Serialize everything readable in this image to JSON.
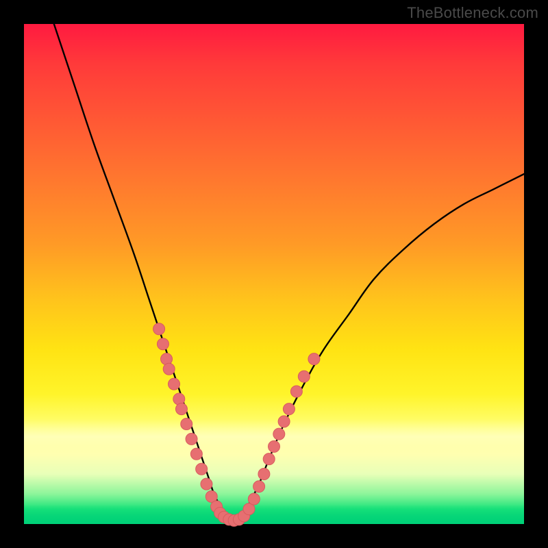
{
  "watermark": "TheBottleneck.com",
  "colors": {
    "frame": "#000000",
    "curve_stroke": "#000000",
    "marker_fill": "#e76f71",
    "marker_stroke": "#d85c5e",
    "gradient_top": "#ff1a40",
    "gradient_bottom": "#00d074"
  },
  "chart_data": {
    "type": "line",
    "title": "",
    "xlabel": "",
    "ylabel": "",
    "xlim": [
      0,
      100
    ],
    "ylim": [
      0,
      100
    ],
    "grid": false,
    "legend": false,
    "series": [
      {
        "name": "bottleneck-curve",
        "x": [
          6,
          10,
          14,
          18,
          22,
          25,
          27,
          29,
          31,
          33,
          35,
          36,
          37,
          38,
          39,
          40,
          41,
          42,
          43,
          44,
          45,
          47,
          49,
          52,
          56,
          60,
          65,
          70,
          76,
          82,
          88,
          94,
          100
        ],
        "y": [
          100,
          88,
          76,
          65,
          54,
          45,
          39,
          33,
          27,
          21,
          15,
          12,
          9,
          6,
          4,
          2,
          1,
          0,
          1,
          2,
          4,
          8,
          13,
          20,
          28,
          35,
          42,
          49,
          55,
          60,
          64,
          67,
          70
        ]
      }
    ],
    "markers": {
      "name": "highlighted-points",
      "points": [
        {
          "x": 27.0,
          "y": 39
        },
        {
          "x": 27.8,
          "y": 36
        },
        {
          "x": 28.5,
          "y": 33
        },
        {
          "x": 29.0,
          "y": 31
        },
        {
          "x": 30.0,
          "y": 28
        },
        {
          "x": 31.0,
          "y": 25
        },
        {
          "x": 31.5,
          "y": 23
        },
        {
          "x": 32.5,
          "y": 20
        },
        {
          "x": 33.5,
          "y": 17
        },
        {
          "x": 34.5,
          "y": 14
        },
        {
          "x": 35.5,
          "y": 11
        },
        {
          "x": 36.5,
          "y": 8
        },
        {
          "x": 37.5,
          "y": 5.5
        },
        {
          "x": 38.5,
          "y": 3.5
        },
        {
          "x": 39.2,
          "y": 2.2
        },
        {
          "x": 40.0,
          "y": 1.4
        },
        {
          "x": 41.0,
          "y": 0.9
        },
        {
          "x": 42.0,
          "y": 0.7
        },
        {
          "x": 43.0,
          "y": 0.9
        },
        {
          "x": 44.0,
          "y": 1.6
        },
        {
          "x": 45.0,
          "y": 3.0
        },
        {
          "x": 46.0,
          "y": 5.0
        },
        {
          "x": 47.0,
          "y": 7.5
        },
        {
          "x": 48.0,
          "y": 10.0
        },
        {
          "x": 49.0,
          "y": 13.0
        },
        {
          "x": 50.0,
          "y": 15.5
        },
        {
          "x": 51.0,
          "y": 18.0
        },
        {
          "x": 52.0,
          "y": 20.5
        },
        {
          "x": 53.0,
          "y": 23.0
        },
        {
          "x": 54.5,
          "y": 26.5
        },
        {
          "x": 56.0,
          "y": 29.5
        },
        {
          "x": 58.0,
          "y": 33.0
        }
      ]
    }
  }
}
